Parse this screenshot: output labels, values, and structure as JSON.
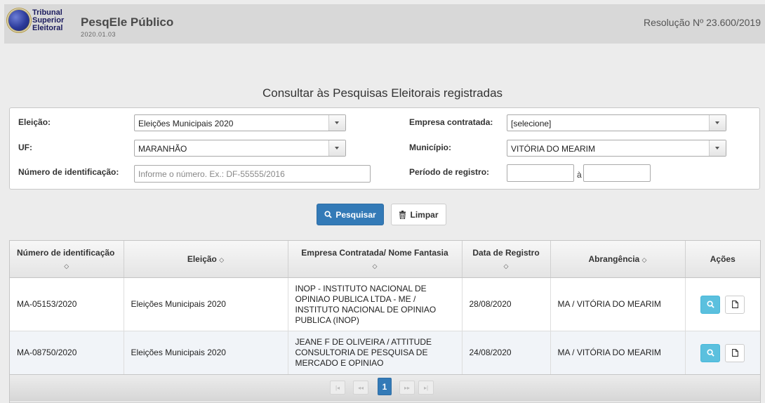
{
  "header": {
    "logo_lines": [
      "Tribunal",
      "Superior",
      "Eleitoral"
    ],
    "app_title": "PesqEle Público",
    "version": "2020.01.03",
    "resolution": "Resolução Nº 23.600/2019"
  },
  "page_heading": "Consultar às Pesquisas Eleitorais registradas",
  "filters": {
    "eleicao": {
      "label": "Eleição:",
      "value": "Eleições Municipais 2020"
    },
    "uf": {
      "label": "UF:",
      "value": "MARANHÃO"
    },
    "numero": {
      "label": "Número de identificação:",
      "placeholder": "Informe o número. Ex.: DF-55555/2016"
    },
    "empresa": {
      "label": "Empresa contratada:",
      "value": "[selecione]"
    },
    "municipio": {
      "label": "Município:",
      "value": "VITÓRIA DO MEARIM"
    },
    "periodo": {
      "label": "Período de registro:",
      "between": "à"
    }
  },
  "buttons": {
    "search": "Pesquisar",
    "clear": "Limpar"
  },
  "table": {
    "columns": [
      "Número de identificação",
      "Eleição",
      "Empresa Contratada/ Nome Fantasia",
      "Data de Registro",
      "Abrangência",
      "Ações"
    ],
    "rows": [
      {
        "numero": "MA-05153/2020",
        "eleicao": "Eleições Municipais 2020",
        "empresa": "INOP - INSTITUTO NACIONAL DE OPINIAO PUBLICA LTDA - ME / INSTITUTO NACIONAL DE OPINIAO PUBLICA (INOP)",
        "data": "28/08/2020",
        "abrangencia": "MA / VITÓRIA DO MEARIM"
      },
      {
        "numero": "MA-08750/2020",
        "eleicao": "Eleições Municipais 2020",
        "empresa": "JEANE F DE OLIVEIRA / ATTITUDE CONSULTORIA DE PESQUISA DE MERCADO E OPINIAO",
        "data": "24/08/2020",
        "abrangencia": "MA / VITÓRIA DO MEARIM"
      }
    ]
  },
  "pager": {
    "current_page": "1"
  },
  "colors": {
    "primary": "#337ab7",
    "info": "#5bc0de",
    "header_bg": "#d8d8d8"
  }
}
